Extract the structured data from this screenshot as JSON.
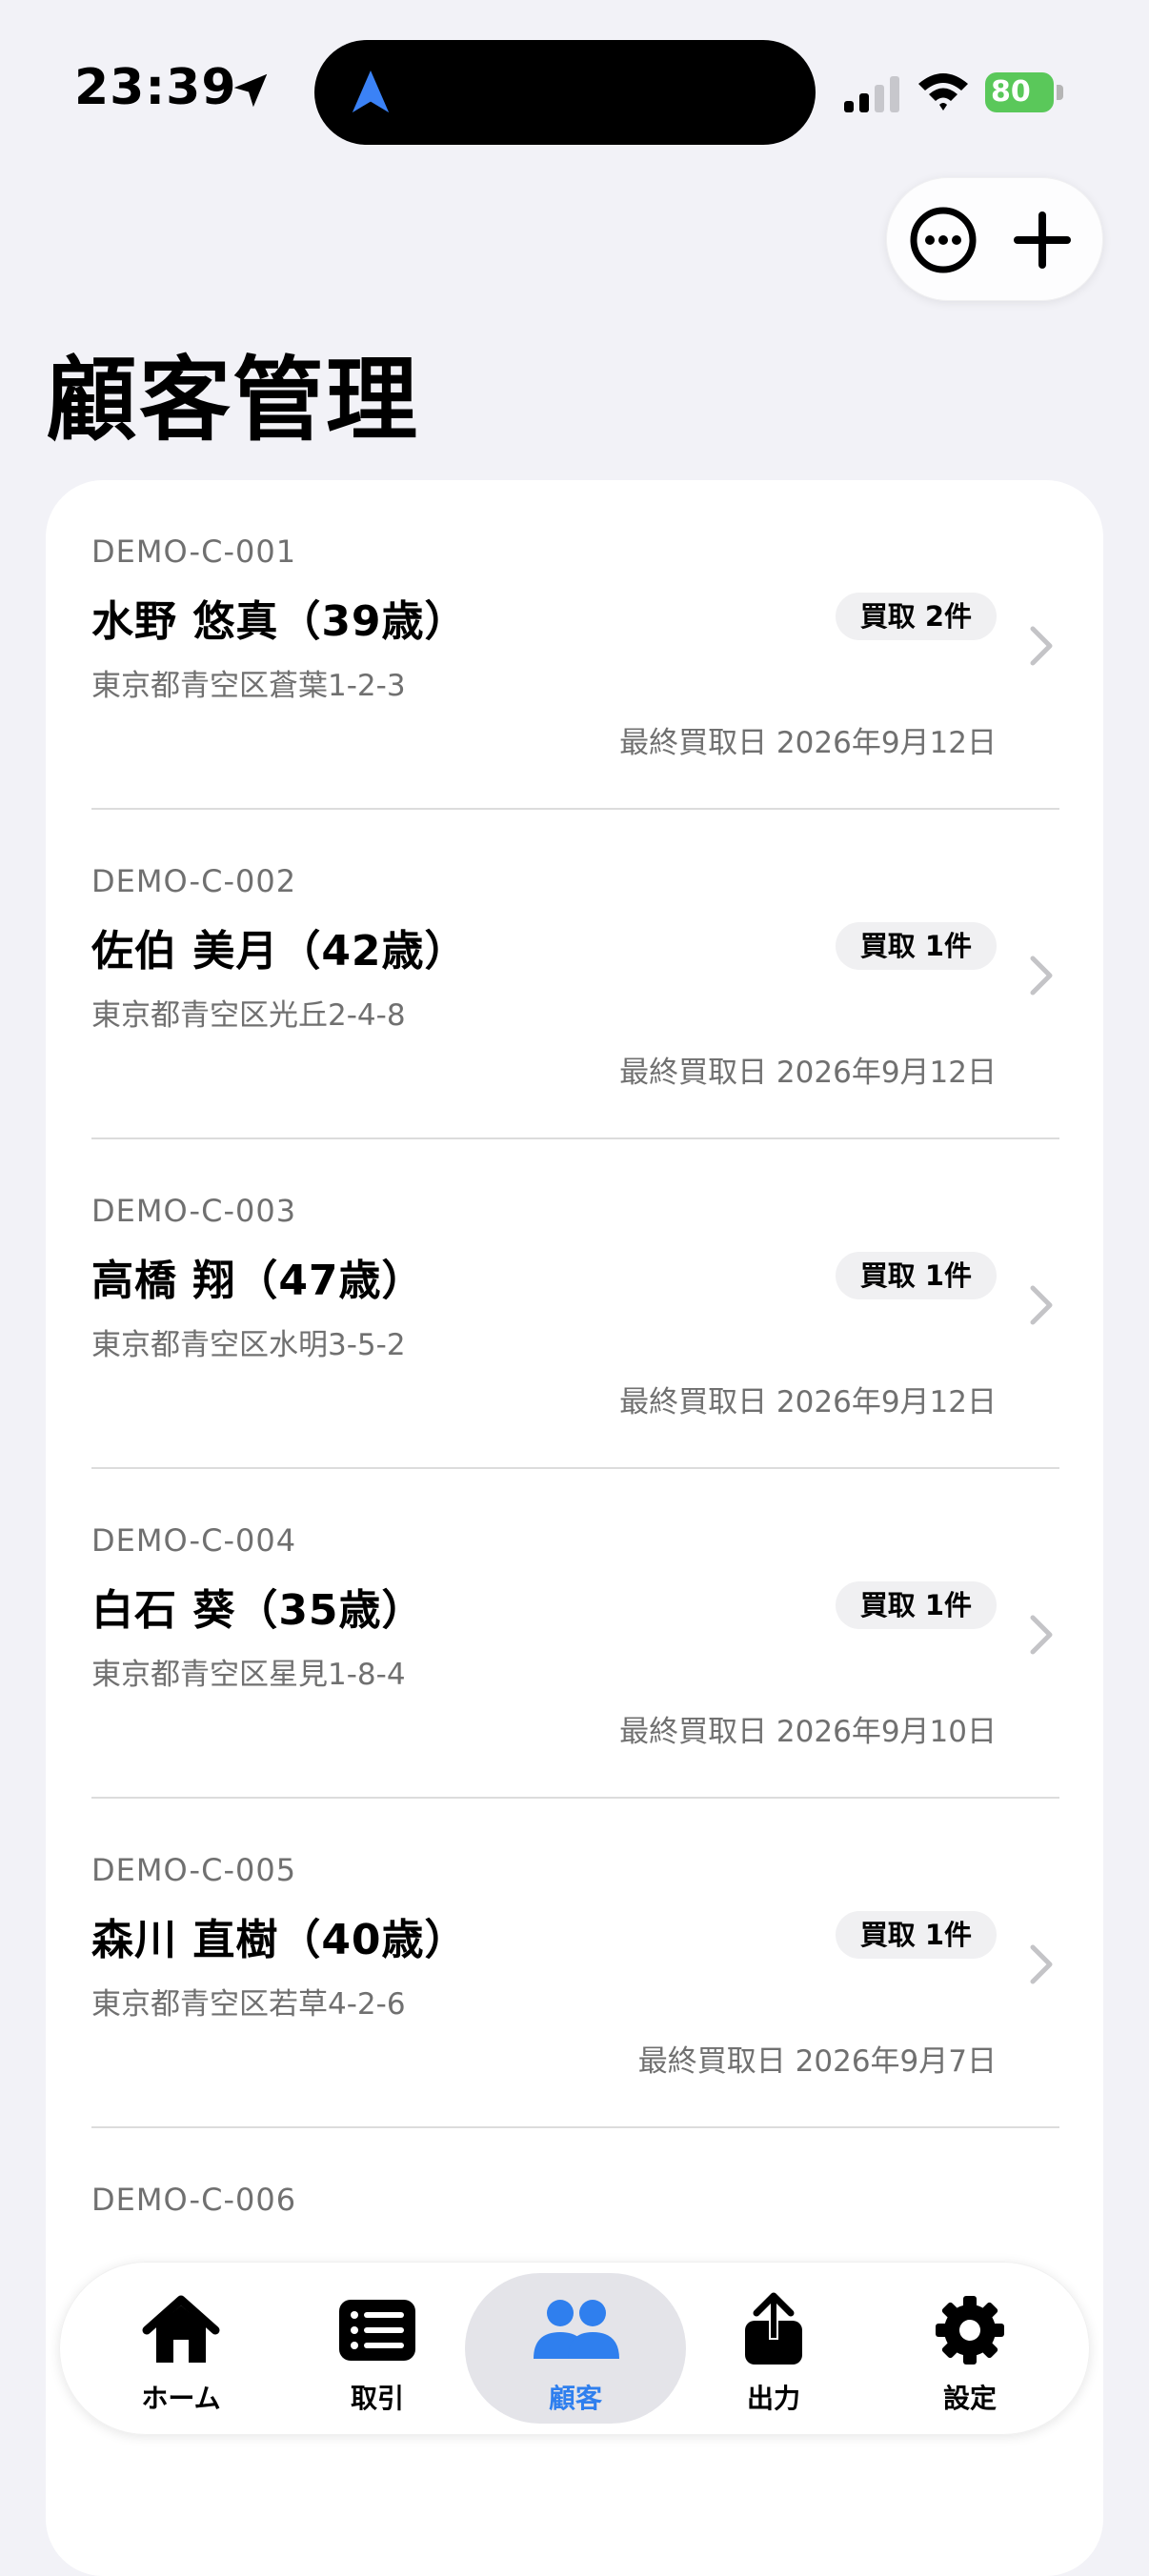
{
  "status_bar": {
    "time": "23:39",
    "battery": "80"
  },
  "page": {
    "title": "顧客管理"
  },
  "customers": [
    {
      "id": "DEMO-C-001",
      "name": "水野 悠真（39歳）",
      "address": "東京都青空区蒼葉1-2-3",
      "badge": "買取 2件",
      "last_purchase": "最終買取日 2026年9月12日"
    },
    {
      "id": "DEMO-C-002",
      "name": "佐伯 美月（42歳）",
      "address": "東京都青空区光丘2-4-8",
      "badge": "買取 1件",
      "last_purchase": "最終買取日 2026年9月12日"
    },
    {
      "id": "DEMO-C-003",
      "name": "高橋 翔（47歳）",
      "address": "東京都青空区水明3-5-2",
      "badge": "買取 1件",
      "last_purchase": "最終買取日 2026年9月12日"
    },
    {
      "id": "DEMO-C-004",
      "name": "白石 葵（35歳）",
      "address": "東京都青空区星見1-8-4",
      "badge": "買取 1件",
      "last_purchase": "最終買取日 2026年9月10日"
    },
    {
      "id": "DEMO-C-005",
      "name": "森川 直樹（40歳）",
      "address": "東京都青空区若草4-2-6",
      "badge": "買取 1件",
      "last_purchase": "最終買取日 2026年9月7日"
    },
    {
      "id": "DEMO-C-006",
      "name": "",
      "address": "",
      "badge": "",
      "last_purchase": ""
    }
  ],
  "tab_bar": {
    "tabs": [
      {
        "label": "ホーム",
        "icon": "house-icon"
      },
      {
        "label": "取引",
        "icon": "list-icon"
      },
      {
        "label": "顧客",
        "icon": "people-icon",
        "active": true
      },
      {
        "label": "出力",
        "icon": "share-icon"
      },
      {
        "label": "設定",
        "icon": "gear-icon"
      }
    ],
    "active_color": "#2f7fee"
  }
}
